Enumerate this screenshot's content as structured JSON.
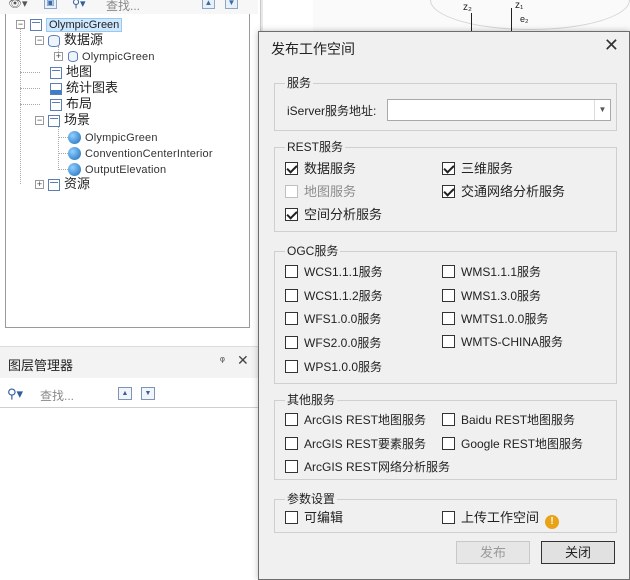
{
  "workspace": {
    "toolbar": {
      "find_placeholder": "查找..."
    },
    "tree": {
      "root": "OlympicGreen",
      "datasources": "数据源",
      "datasource_item": "OlympicGreen",
      "maps": "地图",
      "charts": "统计图表",
      "layouts": "布局",
      "scenes": "场景",
      "scene_items": [
        "OlympicGreen",
        "ConventionCenterInterior",
        "OutputElevation"
      ],
      "resources": "资源"
    }
  },
  "canvas": {
    "axis_labels": [
      "z₂",
      "z₁",
      "e₂"
    ]
  },
  "layer_manager": {
    "title": "图层管理器",
    "pin": "ᵠ",
    "close": "✕",
    "find_placeholder": "查找..."
  },
  "dialog": {
    "title": "发布工作空间",
    "close": "✕",
    "service_group": {
      "legend": "服务",
      "iserver_label": "iServer服务地址:",
      "iserver_value": ""
    },
    "rest_group": {
      "legend": "REST服务",
      "items": [
        {
          "label": "数据服务",
          "checked": true,
          "enabled": true
        },
        {
          "label": "三维服务",
          "checked": true,
          "enabled": true
        },
        {
          "label": "地图服务",
          "checked": false,
          "enabled": false
        },
        {
          "label": "交通网络分析服务",
          "checked": true,
          "enabled": true
        },
        {
          "label": "空间分析服务",
          "checked": true,
          "enabled": true
        }
      ]
    },
    "ogc_group": {
      "legend": "OGC服务",
      "items": [
        {
          "label": "WCS1.1.1服务",
          "checked": false
        },
        {
          "label": "WMS1.1.1服务",
          "checked": false
        },
        {
          "label": "WCS1.1.2服务",
          "checked": false
        },
        {
          "label": "WMS1.3.0服务",
          "checked": false
        },
        {
          "label": "WFS1.0.0服务",
          "checked": false
        },
        {
          "label": "WMTS1.0.0服务",
          "checked": false
        },
        {
          "label": "WFS2.0.0服务",
          "checked": false
        },
        {
          "label": "WMTS-CHINA服务",
          "checked": false
        },
        {
          "label": "WPS1.0.0服务",
          "checked": false
        }
      ]
    },
    "other_group": {
      "legend": "其他服务",
      "items": [
        {
          "label": "ArcGIS REST地图服务",
          "checked": false
        },
        {
          "label": "Baidu REST地图服务",
          "checked": false
        },
        {
          "label": "ArcGIS REST要素服务",
          "checked": false
        },
        {
          "label": "Google REST地图服务",
          "checked": false
        },
        {
          "label": "ArcGIS REST网络分析服务",
          "checked": false
        }
      ]
    },
    "params_group": {
      "legend": "参数设置",
      "editable_label": "可编辑",
      "upload_label": "上传工作空间",
      "warning_icon": "!"
    },
    "publish_button": "发布",
    "close_button": "关闭",
    "colors": {
      "dialog_bg": "#f0f0f0",
      "selection": "#cde8ff",
      "warning": "#e8a317"
    }
  }
}
